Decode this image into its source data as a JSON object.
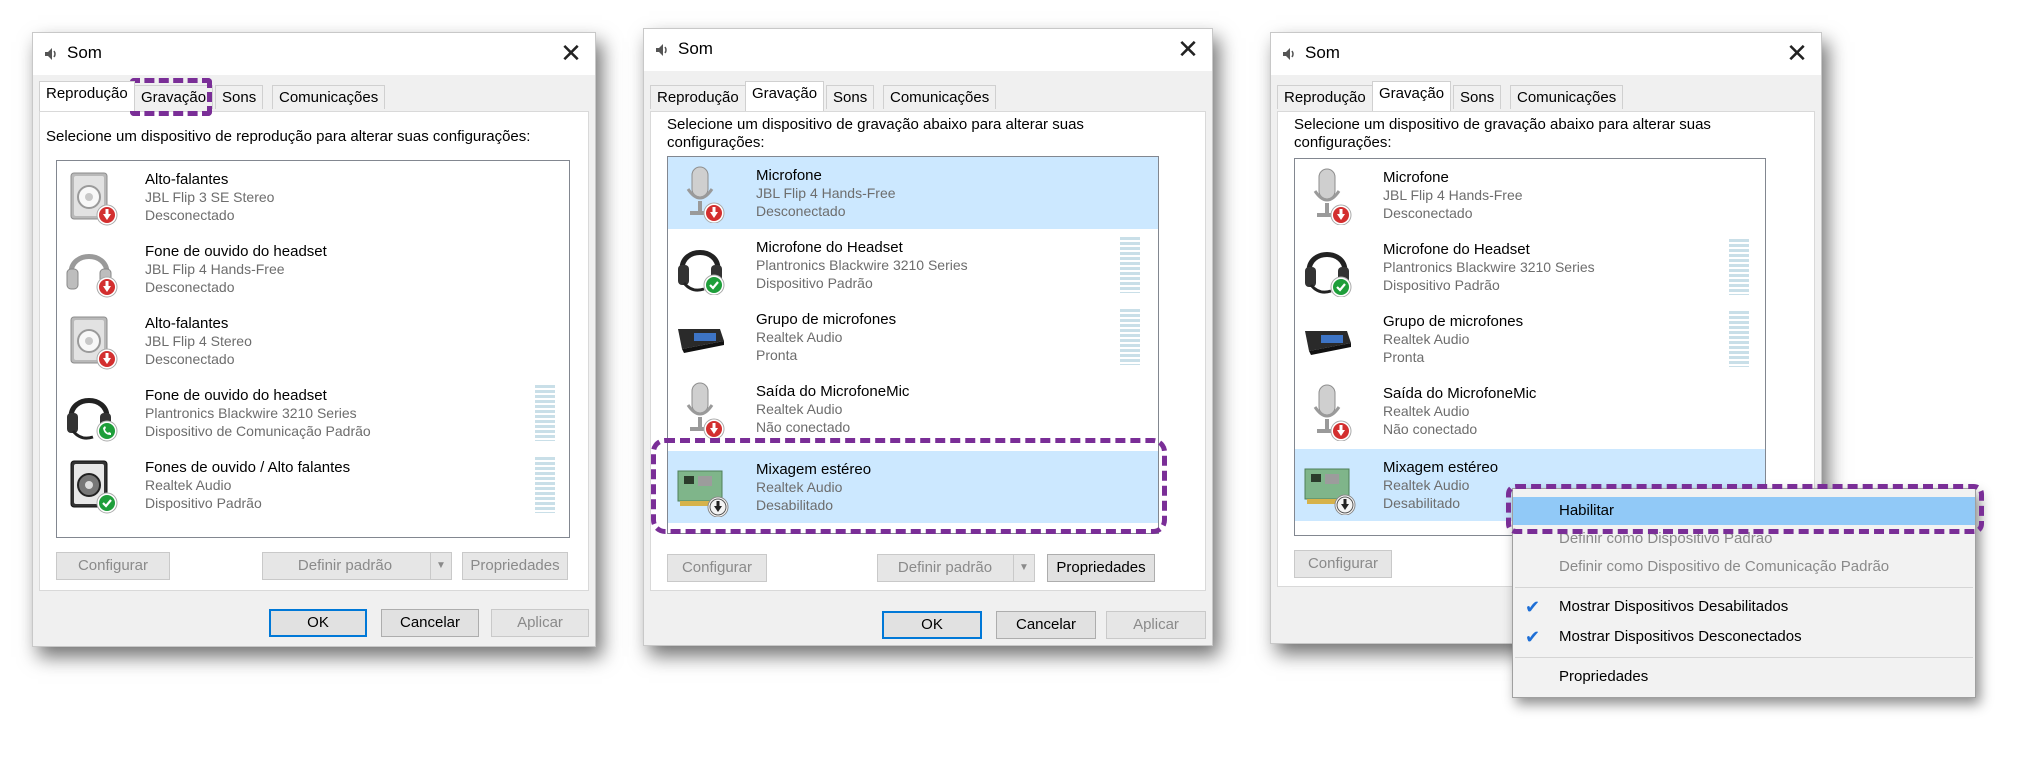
{
  "dialogs": [
    {
      "title": "Som",
      "close_label": "✕",
      "tabs": [
        "Reprodução",
        "Gravação",
        "Sons",
        "Comunicações"
      ],
      "selected_tab": "Reprodução",
      "instruction": "Selecione um dispositivo de reprodução para alterar suas configurações:",
      "devices": [
        {
          "name": "Alto-falantes",
          "desc": "JBL Flip 3 SE Stereo",
          "status": "Desconectado",
          "icon": "speaker-icon",
          "badge": "disconnected-badge-icon"
        },
        {
          "name": "Fone de ouvido do headset",
          "desc": "JBL Flip 4 Hands-Free",
          "status": "Desconectado",
          "icon": "headset-icon",
          "badge": "disconnected-badge-icon"
        },
        {
          "name": "Alto-falantes",
          "desc": "JBL Flip 4 Stereo",
          "status": "Desconectado",
          "icon": "speaker-icon",
          "badge": "disconnected-badge-icon"
        },
        {
          "name": "Fone de ouvido do headset",
          "desc": "Plantronics Blackwire 3210 Series",
          "status": "Dispositivo de Comunicação Padrão",
          "icon": "headset-icon",
          "badge": "phone-badge-icon"
        },
        {
          "name": "Fones de ouvido / Alto falantes",
          "desc": "Realtek Audio",
          "status": "Dispositivo Padrão",
          "icon": "speaker-icon",
          "badge": "default-check-badge-icon"
        }
      ],
      "buttons": {
        "configure": "Configurar",
        "set_default": "Definir padrão",
        "properties": "Propriedades",
        "ok": "OK",
        "cancel": "Cancelar",
        "apply": "Aplicar"
      }
    },
    {
      "title": "Som",
      "close_label": "✕",
      "tabs": [
        "Reprodução",
        "Gravação",
        "Sons",
        "Comunicações"
      ],
      "selected_tab": "Gravação",
      "instruction_line1": "Selecione um dispositivo de gravação abaixo para alterar suas",
      "instruction_line2": "configurações:",
      "devices": [
        {
          "name": "Microfone",
          "desc": "JBL Flip 4 Hands-Free",
          "status": "Desconectado",
          "icon": "microphone-icon",
          "badge": "disconnected-badge-icon"
        },
        {
          "name": "Microfone do Headset",
          "desc": "Plantronics Blackwire 3210 Series",
          "status": "Dispositivo Padrão",
          "icon": "headset-icon",
          "badge": "default-check-badge-icon"
        },
        {
          "name": "Grupo de microfones",
          "desc": "Realtek Audio",
          "status": "Pronta",
          "icon": "mic-array-icon",
          "badge": ""
        },
        {
          "name": "Saída do MicrofoneMic",
          "desc": "Realtek Audio",
          "status": "Não conectado",
          "icon": "microphone-icon",
          "badge": "disconnected-badge-icon"
        },
        {
          "name": "Mixagem estéreo",
          "desc": "Realtek Audio",
          "status": "Desabilitado",
          "icon": "sound-card-icon",
          "badge": "disabled-badge-icon"
        }
      ],
      "buttons": {
        "configure": "Configurar",
        "set_default": "Definir padrão",
        "properties": "Propriedades",
        "ok": "OK",
        "cancel": "Cancelar",
        "apply": "Aplicar"
      }
    },
    {
      "title": "Som",
      "close_label": "✕",
      "tabs": [
        "Reprodução",
        "Gravação",
        "Sons",
        "Comunicações"
      ],
      "selected_tab": "Gravação",
      "instruction_line1": "Selecione um dispositivo de gravação abaixo para alterar suas",
      "instruction_line2": "configurações:",
      "devices": [
        {
          "name": "Microfone",
          "desc": "JBL Flip 4 Hands-Free",
          "status": "Desconectado",
          "icon": "microphone-icon",
          "badge": "disconnected-badge-icon"
        },
        {
          "name": "Microfone do Headset",
          "desc": "Plantronics Blackwire 3210 Series",
          "status": "Dispositivo Padrão",
          "icon": "headset-icon",
          "badge": "default-check-badge-icon"
        },
        {
          "name": "Grupo de microfones",
          "desc": "Realtek Audio",
          "status": "Pronta",
          "icon": "mic-array-icon",
          "badge": ""
        },
        {
          "name": "Saída do MicrofoneMic",
          "desc": "Realtek Audio",
          "status": "Não conectado",
          "icon": "microphone-icon",
          "badge": "disconnected-badge-icon"
        },
        {
          "name": "Mixagem estéreo",
          "desc": "Realtek Audio",
          "status": "Desabilitado",
          "icon": "sound-card-icon",
          "badge": "disabled-badge-icon"
        }
      ],
      "buttons": {
        "configure": "Configurar"
      },
      "context_menu": {
        "enable": "Habilitar",
        "set_default": "Definir como Dispositivo Padrão",
        "set_default_comm": "Definir como Dispositivo de Comunicação Padrão",
        "show_disabled": "Mostrar Dispositivos Desabilitados",
        "show_disconnected": "Mostrar Dispositivos Desconectados",
        "properties": "Propriedades"
      }
    }
  ],
  "colors": {
    "highlight_dash": "#7a2e97",
    "selection": "#cce8ff",
    "menu_highlight": "#91c9f7"
  }
}
